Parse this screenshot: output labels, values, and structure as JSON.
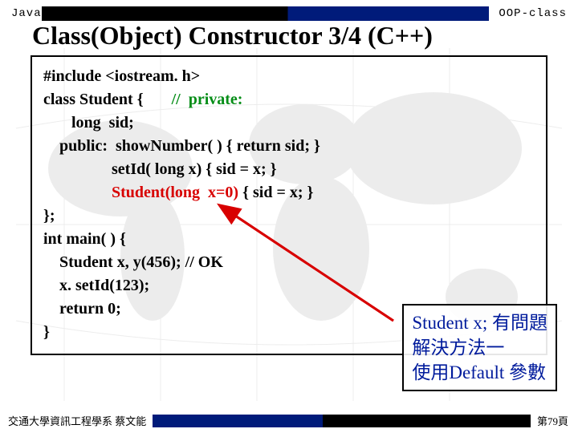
{
  "header": {
    "left_label": "Java",
    "right_label": "OOP-class"
  },
  "title": "Class(Object) Constructor   3/4  (C++)",
  "code": {
    "l1": "#include <iostream. h>",
    "l2a": "class Student {       ",
    "l2b": "//  private:",
    "l3": "       long  sid;",
    "l4": "    public:  showNumber( ) { return sid; }",
    "l5": "                 setId( long x) { sid = x; }",
    "l6a": "                 ",
    "l6b": "Student(long  x=0)",
    "l6c": " { sid = x; }",
    "l7": "};",
    "l8": "int main( ) {",
    "l9": "    Student x, y(456); // OK",
    "l10": "    x. setId(123);",
    "l11": "    return 0;",
    "l12": "}"
  },
  "note": {
    "line1_a": "Student x; ",
    "line1_b": "有問題",
    "line2": " 解決方法一",
    "line3": "  使用Default 參數"
  },
  "footer": {
    "left": "交通大學資訊工程學系  蔡文能",
    "right": "第79頁"
  }
}
